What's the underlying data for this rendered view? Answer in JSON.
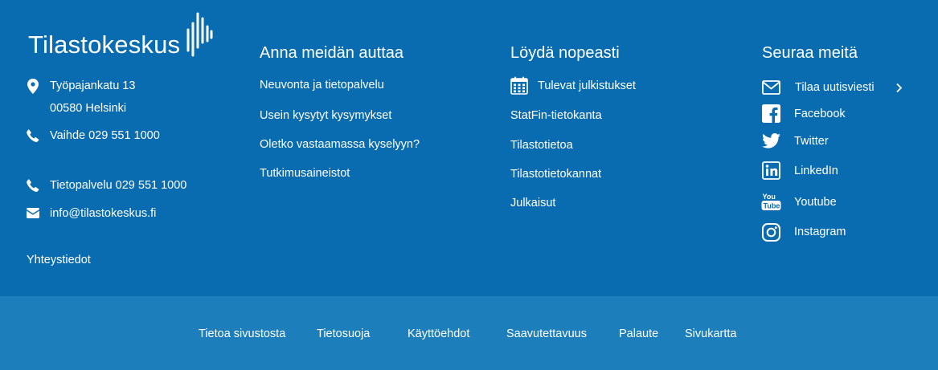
{
  "brand": {
    "name": "Tilastokeskus"
  },
  "contact": {
    "address_line1": "Työpajankatu 13",
    "address_line2": "00580 Helsinki",
    "phone_switchboard": "Vaihde 029 551 1000",
    "phone_info": "Tietopalvelu 029 551 1000",
    "email": "info@tilastokeskus.fi",
    "contact_link": "Yhteystiedot"
  },
  "help": {
    "heading": "Anna meidän auttaa",
    "links": [
      "Neuvonta ja tietopalvelu",
      "Usein kysytyt kysymykset",
      "Oletko vastaamassa kyselyyn?",
      "Tutkimusaineistot"
    ]
  },
  "quick": {
    "heading": "Löydä nopeasti",
    "links": [
      "Tulevat julkistukset",
      "StatFin-tietokanta",
      "Tilastotietoa",
      "Tilastotietokannat",
      "Julkaisut"
    ]
  },
  "follow": {
    "heading": "Seuraa meitä",
    "links": [
      {
        "label": "Tilaa uutisviesti",
        "icon": "envelope-icon"
      },
      {
        "label": "Facebook",
        "icon": "facebook-icon"
      },
      {
        "label": "Twitter",
        "icon": "twitter-icon"
      },
      {
        "label": "LinkedIn",
        "icon": "linkedin-icon"
      },
      {
        "label": "Youtube",
        "icon": "youtube-icon"
      },
      {
        "label": "Instagram",
        "icon": "instagram-icon"
      }
    ]
  },
  "bottom": {
    "links": [
      "Tietoa sivustosta",
      "Tietosuoja",
      "Käyttöehdot",
      "Saavutettavuus",
      "Palaute",
      "Sivukartta"
    ]
  },
  "colors": {
    "main_bg": "#0a6cb0",
    "bottom_bg": "#1c7eba",
    "text": "#ffffff"
  }
}
